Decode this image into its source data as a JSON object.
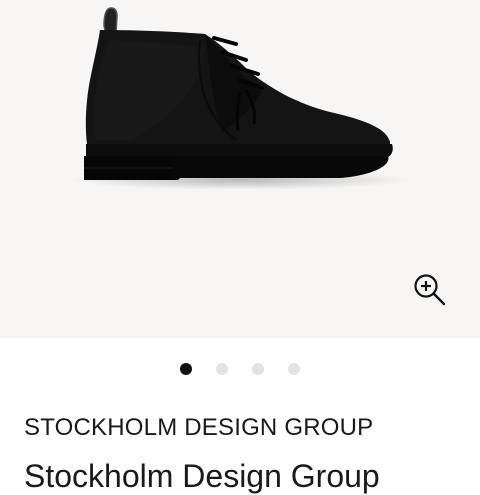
{
  "gallery": {
    "image_alt": "Black suede chukka boot",
    "dots": [
      {
        "active": true
      },
      {
        "active": false
      },
      {
        "active": false
      },
      {
        "active": false
      }
    ],
    "zoom_icon": "zoom-in-icon"
  },
  "product": {
    "brand": "STOCKHOLM DESIGN GROUP",
    "title": "Stockholm Design Group"
  },
  "colors": {
    "gallery_background": "#f7f6f5",
    "dot_active": "#111111",
    "dot_inactive": "#e2e2e2",
    "text": "#1a1a1a"
  }
}
